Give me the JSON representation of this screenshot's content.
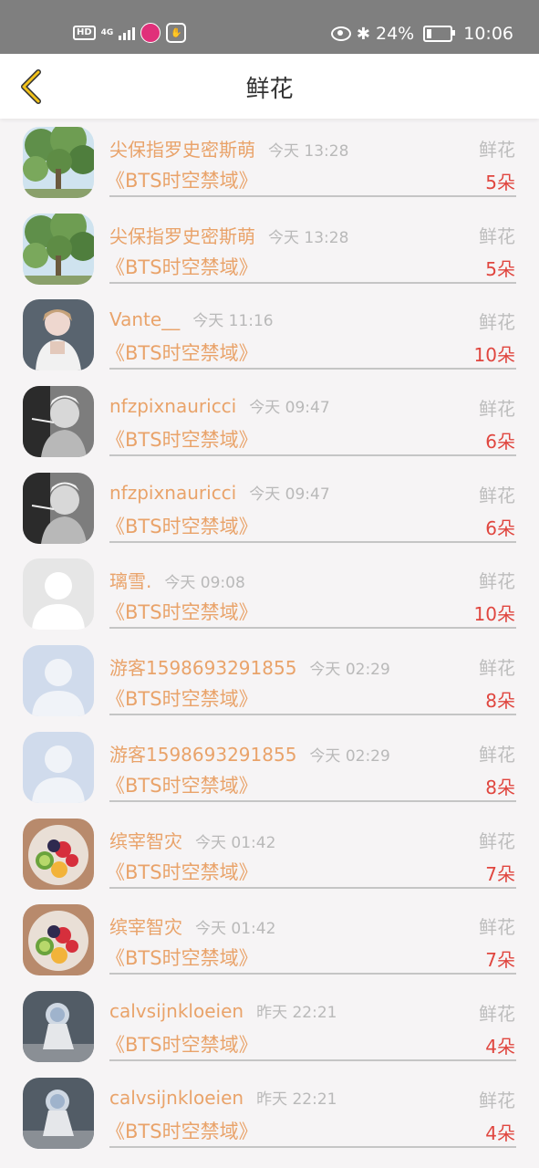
{
  "status_bar": {
    "hd": "HD",
    "network": "4G",
    "battery_text": "24%",
    "battery_level": 0.24,
    "time": "10:06"
  },
  "header": {
    "title": "鲜花"
  },
  "rows": [
    {
      "name": "尖保指罗史密斯萌",
      "time": "今天 13:28",
      "type": "鲜花",
      "book": "《BTS时空禁域》",
      "count": "5朵",
      "avatar": "tree-avatar"
    },
    {
      "name": "尖保指罗史密斯萌",
      "time": "今天 13:28",
      "type": "鲜花",
      "book": "《BTS时空禁域》",
      "count": "5朵",
      "avatar": "tree-avatar"
    },
    {
      "name": "Vante__",
      "time": "今天 11:16",
      "type": "鲜花",
      "book": "《BTS时空禁域》",
      "count": "10朵",
      "avatar": "person-avatar"
    },
    {
      "name": "nfzpixnauricci",
      "time": "今天 09:47",
      "type": "鲜花",
      "book": "《BTS时空禁域》",
      "count": "6朵",
      "avatar": "smoking-avatar"
    },
    {
      "name": "nfzpixnauricci",
      "time": "今天 09:47",
      "type": "鲜花",
      "book": "《BTS时空禁域》",
      "count": "6朵",
      "avatar": "smoking-avatar"
    },
    {
      "name": "璃雪.",
      "time": "今天 09:08",
      "type": "鲜花",
      "book": "《BTS时空禁域》",
      "count": "10朵",
      "avatar": "default-gray-avatar"
    },
    {
      "name": "游客1598693291855",
      "time": "今天 02:29",
      "type": "鲜花",
      "book": "《BTS时空禁域》",
      "count": "8朵",
      "avatar": "default-blue-avatar"
    },
    {
      "name": "游客1598693291855",
      "time": "今天 02:29",
      "type": "鲜花",
      "book": "《BTS时空禁域》",
      "count": "8朵",
      "avatar": "default-blue-avatar"
    },
    {
      "name": "缤宰智灾",
      "time": "今天 01:42",
      "type": "鲜花",
      "book": "《BTS时空禁域》",
      "count": "7朵",
      "avatar": "fruit-avatar"
    },
    {
      "name": "缤宰智灾",
      "time": "今天 01:42",
      "type": "鲜花",
      "book": "《BTS时空禁域》",
      "count": "7朵",
      "avatar": "fruit-avatar"
    },
    {
      "name": "calvsijnkloeien",
      "time": "昨天 22:21",
      "type": "鲜花",
      "book": "《BTS时空禁域》",
      "count": "4朵",
      "avatar": "figurine-avatar"
    },
    {
      "name": "calvsijnkloeien",
      "time": "昨天 22:21",
      "type": "鲜花",
      "book": "《BTS时空禁域》",
      "count": "4朵",
      "avatar": "figurine-avatar"
    }
  ]
}
